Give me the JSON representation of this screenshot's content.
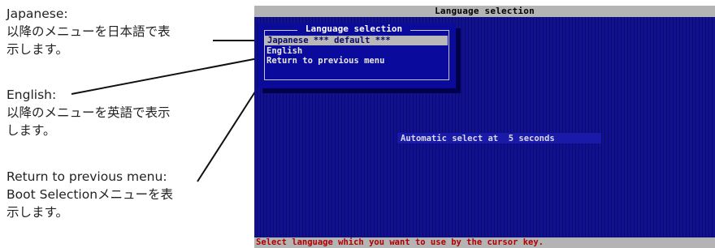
{
  "annotations": {
    "japanese": {
      "label": "Japanese:",
      "desc_line1": "以降のメニューを日本語で表",
      "desc_line2": "示します。"
    },
    "english": {
      "label": "English:",
      "desc_line1": "以降のメニューを英語で表示",
      "desc_line2": "します。"
    },
    "return": {
      "label": "Return to previous menu:",
      "desc_line1": "Boot Selectionメニューを表",
      "desc_line2": "示します。"
    }
  },
  "console": {
    "title": "Language selection",
    "dialog": {
      "title": "Language selection",
      "items": [
        {
          "label": "Japanese *** default ***",
          "selected": true
        },
        {
          "label": "English",
          "selected": false
        },
        {
          "label": "Return to previous menu",
          "selected": false
        }
      ]
    },
    "auto_select": "Automatic select at  5 seconds",
    "help_text": "Select language which you want to use by the cursor key."
  },
  "colors": {
    "screen_bg": "#0d0d8c",
    "bar_bg": "#b4b4b4",
    "help_text": "#b00000",
    "selected_bg": "#b8b8b8"
  }
}
